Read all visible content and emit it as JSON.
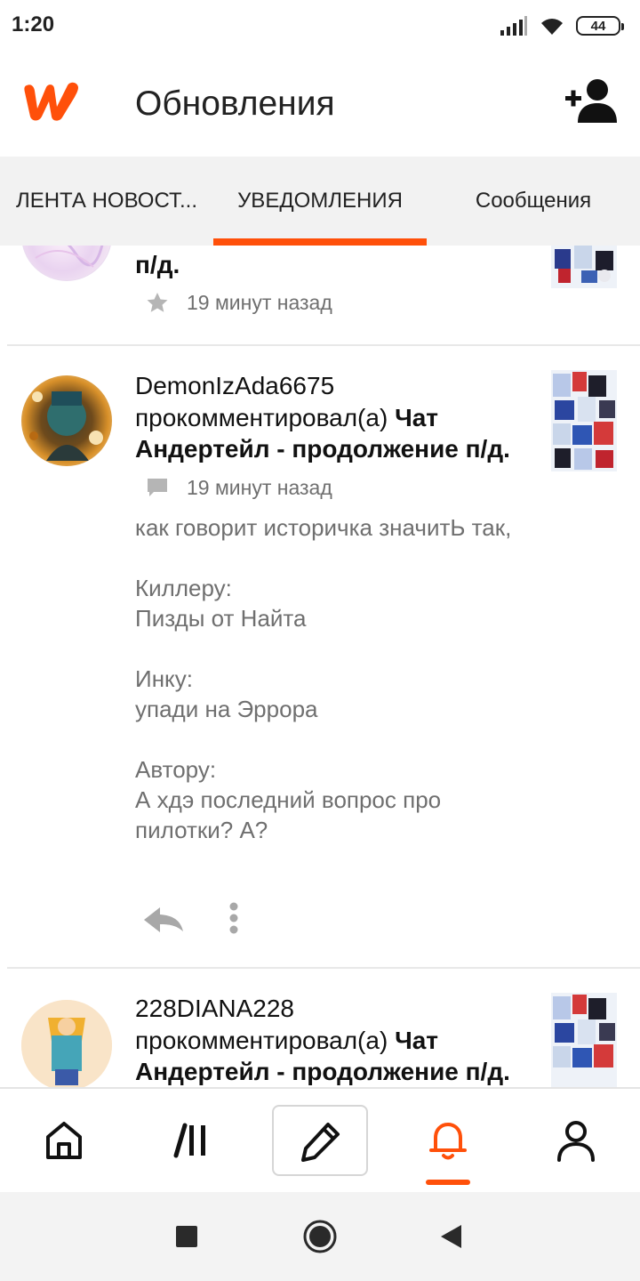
{
  "status_bar": {
    "time": "1:20",
    "battery": "44"
  },
  "header": {
    "title": "Обновления"
  },
  "tabs": [
    {
      "label": "ЛЕНТА НОВОСТ..."
    },
    {
      "label": "УВЕДОМЛЕНИЯ"
    },
    {
      "label": "Сообщения"
    }
  ],
  "notifications": [
    {
      "desc_tail": "п/д.",
      "time": "19 минут назад"
    },
    {
      "username": "DemonIzAda6675",
      "action": "прокомментировал(а)",
      "story": "Чат Андертейл - продолжение п/д.",
      "time": "19 минут назад",
      "comment": "как говорит историчка значитЬ так,\n\nКиллеру:\nПизды от Найта\n\nИнку:\nупади на Эррора\n\nАвтору:\nА хдэ последний вопрос про пилотки? А?"
    },
    {
      "username": "228DIANA228",
      "action": "прокомментировал(а)",
      "story": "Чат Андертейл - продолжение п/д."
    }
  ],
  "colors": {
    "accent": "#ff500a",
    "muted": "#6f6f6f"
  }
}
